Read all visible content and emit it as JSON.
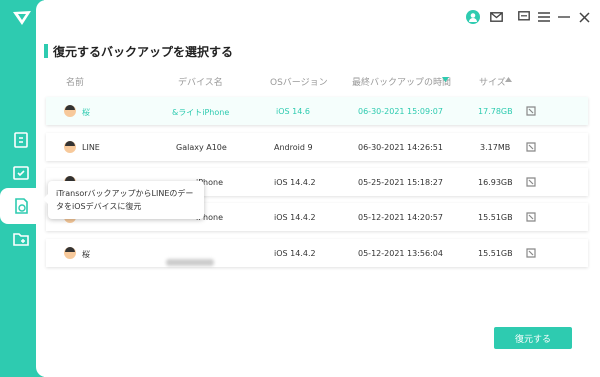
{
  "app": {
    "accent": "#2ecbb0"
  },
  "page_title": "復元するバックアップを選択する",
  "columns": {
    "name": "名前",
    "device": "デバイス名",
    "os": "OSバージョン",
    "time": "最終バックアップの時間",
    "size": "サイズ"
  },
  "rows": [
    {
      "name": "桜",
      "device": "&ライトiPhone",
      "os": "iOS 14.6",
      "time": "06-30-2021 15:09:07",
      "size": "17.78GB"
    },
    {
      "name": "LINE",
      "device": "Galaxy A10e",
      "os": "Android 9",
      "time": "06-30-2021 14:26:51",
      "size": "3.17MB"
    },
    {
      "name": "",
      "device": "iPhone",
      "os": "iOS 14.4.2",
      "time": "05-25-2021 15:18:27",
      "size": "16.93GB"
    },
    {
      "name": "",
      "device": "iPhone",
      "os": "iOS 14.4.2",
      "time": "05-12-2021 14:20:57",
      "size": "15.51GB"
    },
    {
      "name": "桜",
      "device": "",
      "os": "iOS 14.4.2",
      "time": "05-12-2021 13:56:04",
      "size": "15.51GB"
    }
  ],
  "tooltip": "iTransorバックアップからLINEのデータをiOSデバイスに復元",
  "restore_button": "復元する",
  "icons": {
    "logo": "app-logo-icon",
    "user": "user-icon",
    "mail": "mail-icon",
    "feedback": "feedback-icon",
    "menu": "menu-icon",
    "minimize": "minimize-icon",
    "close": "close-icon"
  }
}
